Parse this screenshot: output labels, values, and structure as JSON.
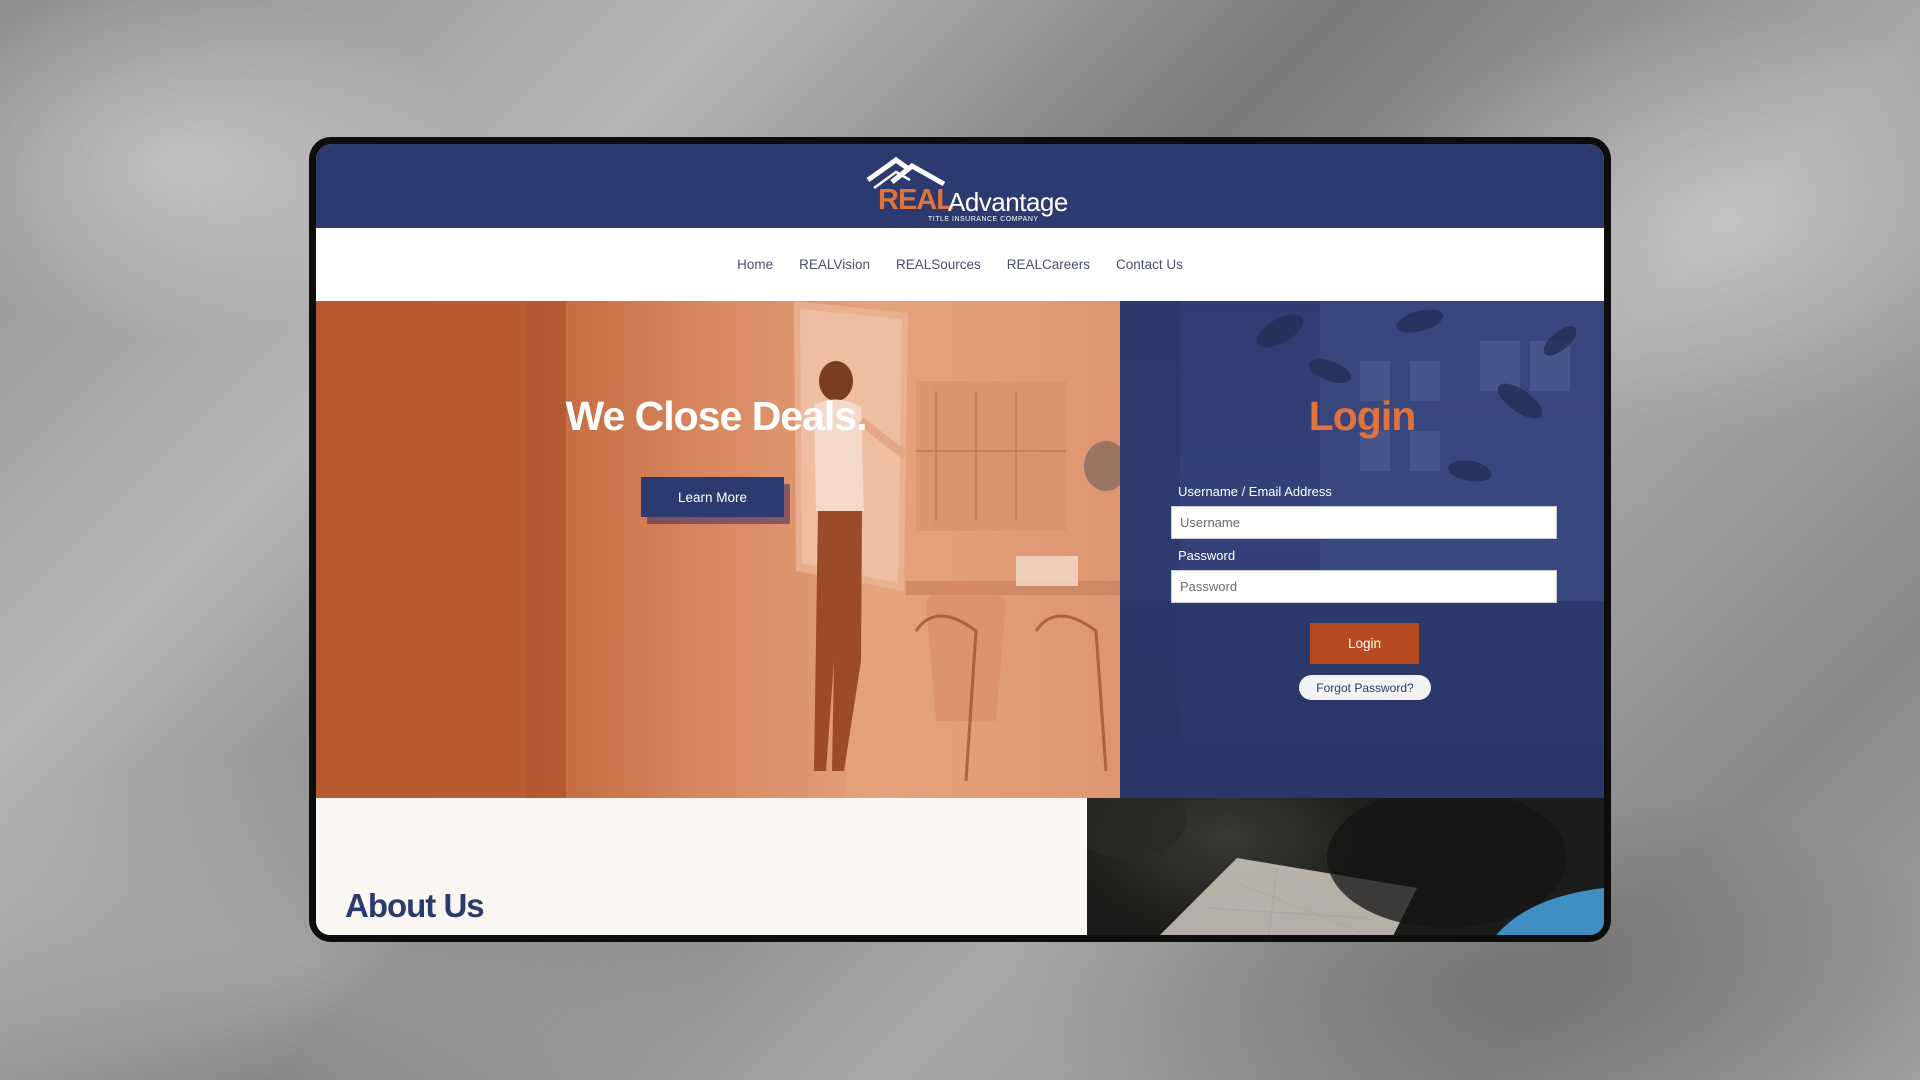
{
  "brand": {
    "name_part1": "REAL",
    "name_part2": "Advantage",
    "tagline": "TITLE INSURANCE COMPANY"
  },
  "nav": {
    "items": [
      {
        "label": "Home"
      },
      {
        "label": "REALVision"
      },
      {
        "label": "REALSources"
      },
      {
        "label": "REALCareers"
      },
      {
        "label": "Contact Us"
      }
    ]
  },
  "hero": {
    "title": "We Close Deals.",
    "learn_more_label": "Learn More"
  },
  "login": {
    "title": "Login",
    "username_label": "Username / Email Address",
    "username_placeholder": "Username",
    "password_label": "Password",
    "password_placeholder": "Password",
    "submit_label": "Login",
    "forgot_label": "Forgot Password?"
  },
  "about": {
    "title": "About Us"
  },
  "colors": {
    "navy": "#2c3b6f",
    "orange": "#e0733c",
    "login_button": "#b84a22"
  }
}
